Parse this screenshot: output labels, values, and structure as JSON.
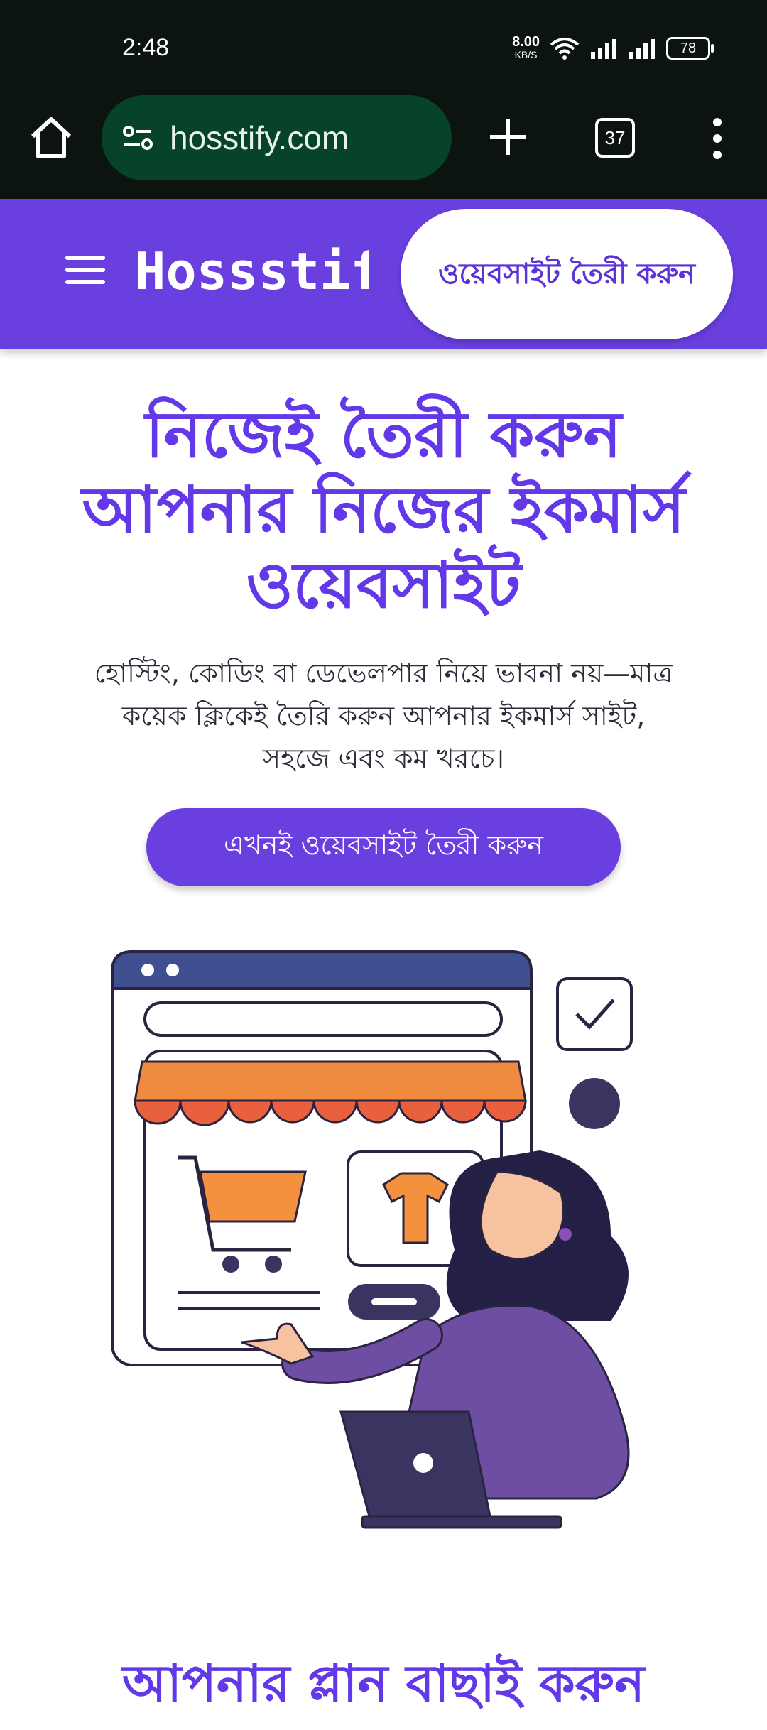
{
  "status": {
    "time": "2:48",
    "speed_value": "8.00",
    "speed_unit": "KB/S",
    "battery": "78"
  },
  "browser": {
    "url": "hosstify.com",
    "tab_count": "37"
  },
  "header": {
    "logo": "Hossstify",
    "cta_label": "ওয়েবসাইট তৈরী করুন"
  },
  "hero": {
    "title": "নিজেই তৈরী করুন আপনার নিজের ইকমার্স ওয়েবসাইট",
    "subtitle": "হোস্টিং, কোডিং বা ডেভেলপার নিয়ে ভাবনা নয়—মাত্র কয়েক ক্লিকেই তৈরি করুন আপনার ইকমার্স সাইট, সহজে এবং কম খরচে।",
    "cta_label": "এখনই ওয়েবসাইট তৈরী করুন"
  },
  "plans": {
    "title": "আপনার প্লান বাছাই করুন"
  },
  "colors": {
    "brand": "#6a3fe0",
    "heading": "#6338e8",
    "browser_bg": "#0b140f",
    "url_pill": "#06432a"
  }
}
